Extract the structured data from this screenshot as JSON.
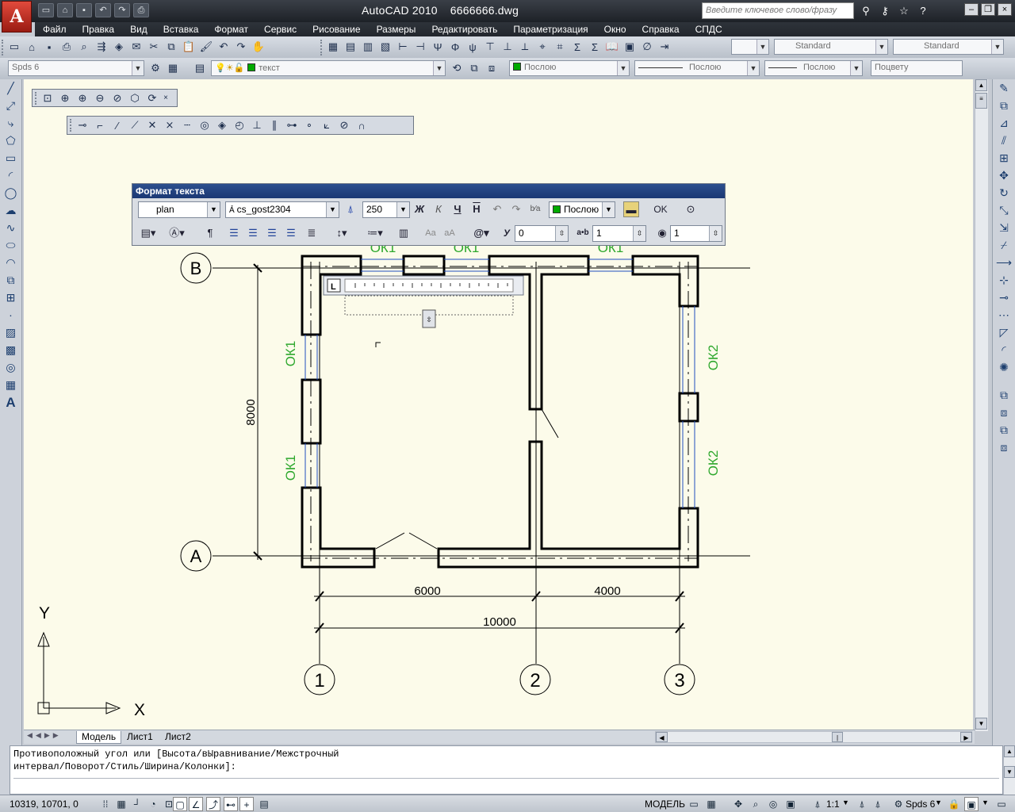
{
  "app": {
    "logo_letter": "A",
    "title_app": "AutoCAD 2010",
    "title_file": "6666666.dwg",
    "search_placeholder": "Введите ключевое слово/фразу"
  },
  "menu": [
    "Файл",
    "Правка",
    "Вид",
    "Вставка",
    "Формат",
    "Сервис",
    "Рисование",
    "Размеры",
    "Редактировать",
    "Параметризация",
    "Окно",
    "Справка",
    "СПДС"
  ],
  "toolbars": {
    "text_style": "Standard",
    "dim_style": "Standard",
    "workspace": "Spds 6",
    "layer": "текст",
    "color": "Послою",
    "linetype": "Послою",
    "lineweight": "Послою",
    "plotstyle": "Поцвету"
  },
  "text_format": {
    "title": "Формат текста",
    "style": "plan",
    "font": "cs_gost2304",
    "height": "250",
    "bold": "Ж",
    "italic": "К",
    "underline": "Ч",
    "overline": "Н",
    "color": "Послою",
    "ok": "OK",
    "oblique": "0",
    "tracking": "1",
    "width": "1",
    "oblique_label": "У",
    "tracking_label": "a•b"
  },
  "drawing": {
    "axes_letters": [
      "В",
      "А"
    ],
    "axes_numbers": [
      "1",
      "2",
      "3"
    ],
    "dims": {
      "span1": "6000",
      "span2": "4000",
      "total": "10000",
      "height": "8000"
    },
    "windows": {
      "top": [
        "ОК1",
        "ОК1",
        "ОК1"
      ],
      "left": [
        "ОК1",
        "ОК1"
      ],
      "right": [
        "ОК2",
        "ОК2"
      ]
    },
    "ucs_x": "X",
    "ucs_y": "Y"
  },
  "tabs": [
    "Модель",
    "Лист1",
    "Лист2"
  ],
  "command": {
    "line1": "Противоположный угол или [Высота/вЫравнивание/Межстрочный",
    "line2": "интервал/Поворот/Стиль/Ширина/Колонки]:"
  },
  "status": {
    "coords": "10319, 10701, 0",
    "space": "МОДЕЛЬ",
    "scale": "1:1",
    "workspace": "Spds 6"
  },
  "colors": {
    "canvas": "#fcfbea",
    "wall": "#000000",
    "window_line": "#1f4fbf",
    "window_label": "#2ea82e",
    "titlebar": "#23272d"
  }
}
